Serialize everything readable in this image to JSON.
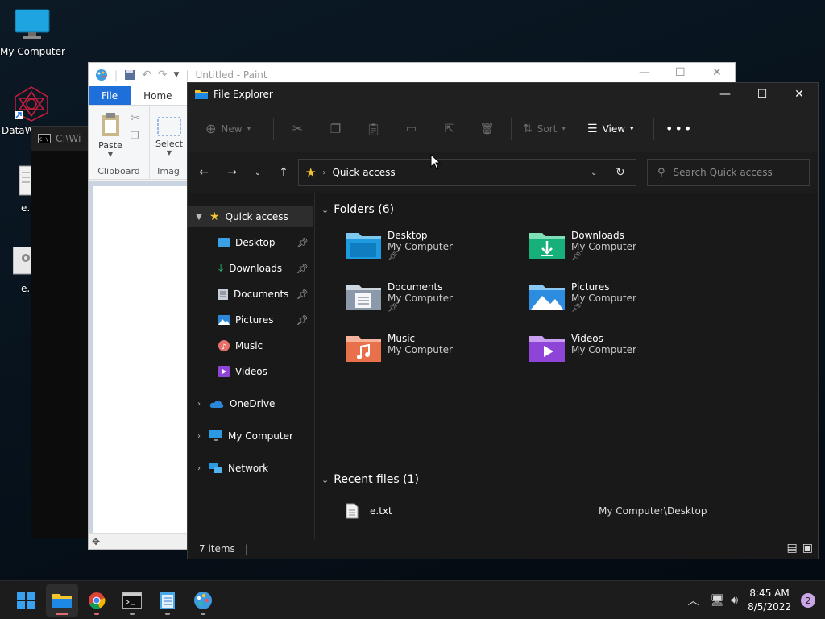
{
  "desktop": {
    "icons": [
      {
        "label": "My Computer"
      },
      {
        "label": "DataW"
      },
      {
        "label": "e.t"
      },
      {
        "label": "e.b"
      }
    ]
  },
  "console": {
    "title": "C:\\Wi"
  },
  "paint": {
    "title": "Untitled - Paint",
    "tabs": {
      "file": "File",
      "home": "Home"
    },
    "ribbon": {
      "paste": "Paste",
      "select": "Select",
      "clipboard_group": "Clipboard",
      "image_group": "Imag"
    }
  },
  "explorer": {
    "title": "File Explorer",
    "commands": {
      "new": "New",
      "sort": "Sort",
      "view": "View"
    },
    "address": {
      "location": "Quick access"
    },
    "search": {
      "placeholder": "Search Quick access"
    },
    "nav": {
      "quick_access": "Quick access",
      "items": [
        {
          "label": "Desktop",
          "pinned": true
        },
        {
          "label": "Downloads",
          "pinned": true
        },
        {
          "label": "Documents",
          "pinned": true
        },
        {
          "label": "Pictures",
          "pinned": true
        },
        {
          "label": "Music",
          "pinned": false
        },
        {
          "label": "Videos",
          "pinned": false
        }
      ],
      "onedrive": "OneDrive",
      "my_computer": "My Computer",
      "network": "Network"
    },
    "folders_header": "Folders (6)",
    "folders": [
      {
        "name": "Desktop",
        "location": "My Computer",
        "pinned": true
      },
      {
        "name": "Downloads",
        "location": "My Computer",
        "pinned": true
      },
      {
        "name": "Documents",
        "location": "My Computer",
        "pinned": true
      },
      {
        "name": "Pictures",
        "location": "My Computer",
        "pinned": true
      },
      {
        "name": "Music",
        "location": "My Computer",
        "pinned": false
      },
      {
        "name": "Videos",
        "location": "My Computer",
        "pinned": false
      }
    ],
    "recent_header": "Recent files (1)",
    "recent": [
      {
        "name": "e.txt",
        "location": "My Computer\\Desktop"
      }
    ],
    "status": "7 items"
  },
  "taskbar": {
    "time": "8:45 AM",
    "date": "8/5/2022",
    "notifications": "2"
  },
  "colors": {
    "accent": "#1e6fd9",
    "explorer_bg": "#191919",
    "star": "#f4c430"
  }
}
